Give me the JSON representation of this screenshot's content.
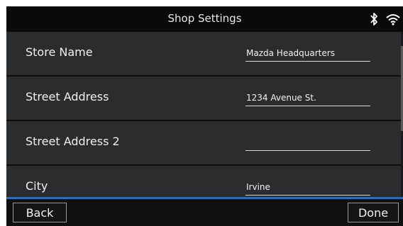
{
  "header": {
    "title": "Shop Settings",
    "status_icons": [
      "bluetooth-icon",
      "wifi-icon"
    ]
  },
  "fields": [
    {
      "label": "Store Name",
      "value": "Mazda Headquarters"
    },
    {
      "label": "Street Address",
      "value": "1234 Avenue St."
    },
    {
      "label": "Street Address 2",
      "value": ""
    },
    {
      "label": "City",
      "value": "Irvine"
    }
  ],
  "footer": {
    "back_label": "Back",
    "done_label": "Done"
  },
  "colors": {
    "accent_line": "#2e6db3",
    "background": "#2b2c2e"
  }
}
